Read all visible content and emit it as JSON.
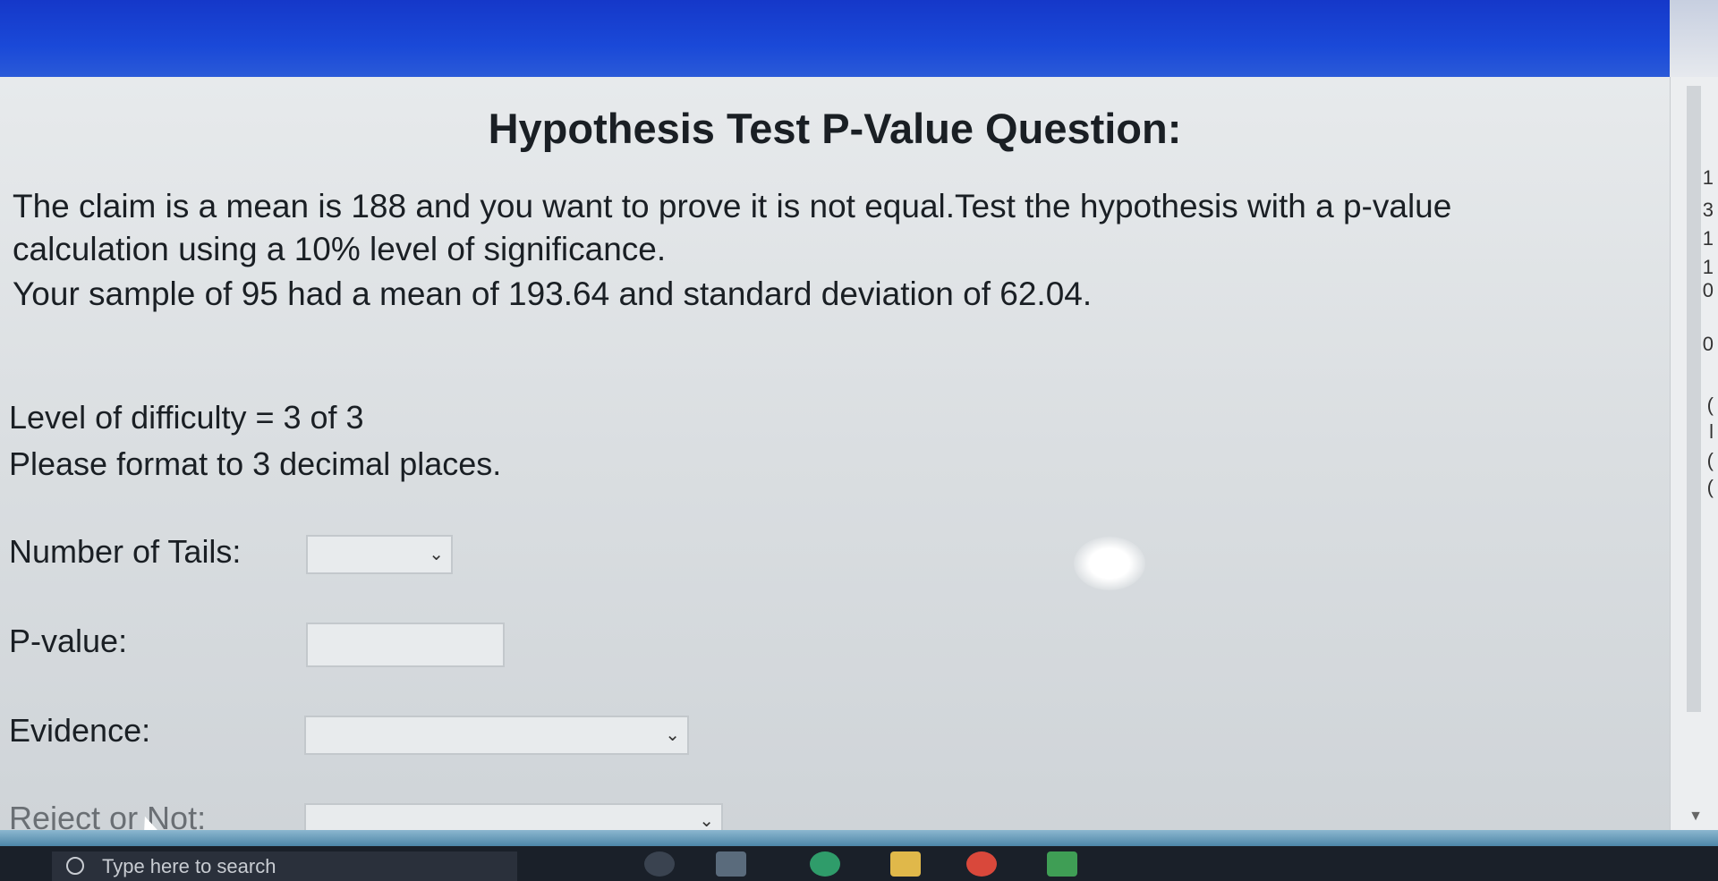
{
  "page": {
    "title": "Hypothesis Test P-Value Question:",
    "question_lines": [
      "The claim is a mean is 188 and you want to prove it is not equal.Test the hypothesis with a p-value",
      "calculation using a 10% level of significance.",
      "Your sample of 95 had a mean of 193.64 and standard deviation of 62.04."
    ],
    "difficulty": "Level of difficulty = 3 of 3",
    "format_note": "Please format to 3 decimal places."
  },
  "form": {
    "tails_label": "Number of Tails:",
    "tails_value": "",
    "pvalue_label": "P-value:",
    "pvalue_value": "",
    "evidence_label": "Evidence:",
    "evidence_value": "",
    "reject_label": "Reject or Not:",
    "reject_value": ""
  },
  "side_digits": [
    "1",
    "3",
    "1",
    "1",
    "0",
    "0",
    "(",
    "l",
    "(",
    "("
  ],
  "taskbar": {
    "search_placeholder": "Type here to search"
  },
  "icons": {
    "dropdown": "chevron-down-icon",
    "search": "search-icon",
    "cursor": "mouse-pointer-icon"
  },
  "colors": {
    "header_blue": "#1538c9",
    "page_bg": "#dadee1",
    "taskbar": "#1a2029"
  }
}
